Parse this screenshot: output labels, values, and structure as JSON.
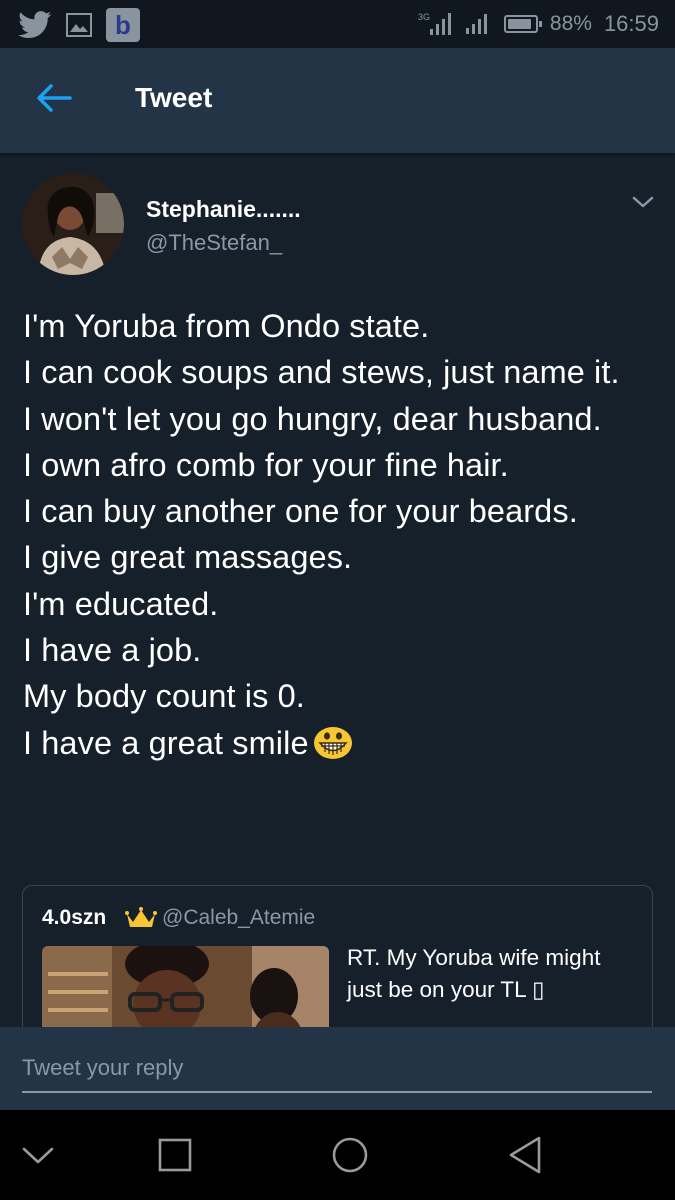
{
  "status_bar": {
    "network": "3G",
    "battery": "88%",
    "battery_level": 0.88,
    "time": "16:59",
    "icons": [
      "twitter-icon",
      "image-icon",
      "app-b-icon",
      "signal-icon",
      "signal-icon",
      "battery-icon"
    ],
    "app_letter": "b"
  },
  "header": {
    "title": "Tweet"
  },
  "tweet": {
    "author_name": "Stephanie.......",
    "author_handle": "@TheStefan_",
    "text": "I'm Yoruba from Ondo state.\nI can cook soups and stews, just name it.\nI won't let you go hungry, dear husband.\nI own afro comb for your fine hair.\nI can buy another one for your beards.\nI give great massages.\nI'm educated.\nI have a job.\nMy body count is 0.\nI have a great smile"
  },
  "quoted_tweet": {
    "name": "4.0szn",
    "handle": "@Caleb_Atemie",
    "text": "RT. My Yoruba wife might just be on your TL ▯"
  },
  "reply": {
    "placeholder": "Tweet your reply"
  },
  "colors": {
    "background": "#15202b",
    "header": "#243447",
    "secondary_text": "#8899a6",
    "accent": "#1da1f2"
  }
}
